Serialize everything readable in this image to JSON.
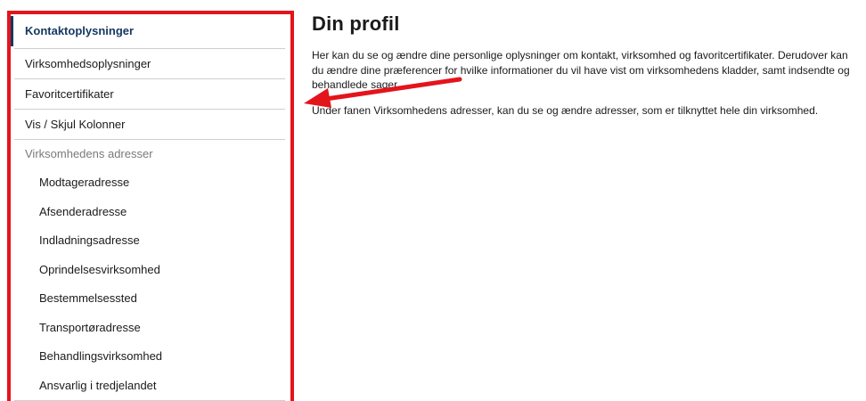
{
  "sidebar": {
    "items": [
      {
        "label": "Kontaktoplysninger"
      },
      {
        "label": "Virksomhedsoplysninger"
      },
      {
        "label": "Favoritcertifikater"
      },
      {
        "label": "Vis / Skjul Kolonner"
      }
    ],
    "group": {
      "label": "Virksomhedens adresser",
      "items": [
        {
          "label": "Modtageradresse"
        },
        {
          "label": "Afsenderadresse"
        },
        {
          "label": "Indladningsadresse"
        },
        {
          "label": "Oprindelsesvirksomhed"
        },
        {
          "label": "Bestemmelsessted"
        },
        {
          "label": "Transportøradresse"
        },
        {
          "label": "Behandlingsvirksomhed"
        },
        {
          "label": "Ansvarlig i tredjelandet"
        }
      ]
    }
  },
  "main": {
    "title": "Din profil",
    "paragraph1": "Her kan du se og ændre dine personlige oplysninger om kontakt, virksomhed og favoritcertifikater. Derudover kan du ændre dine præferencer for hvilke informationer du vil have vist om virksomhedens kladder, samt indsendte og behandlede sager.",
    "paragraph2": "Under fanen Virksomhedens adresser, kan du se og ændre adresser, som er tilknyttet hele din virksomhed."
  },
  "colors": {
    "highlight_border": "#e4141b",
    "active_text": "#14385f",
    "annotation_arrow": "#e4141b"
  }
}
